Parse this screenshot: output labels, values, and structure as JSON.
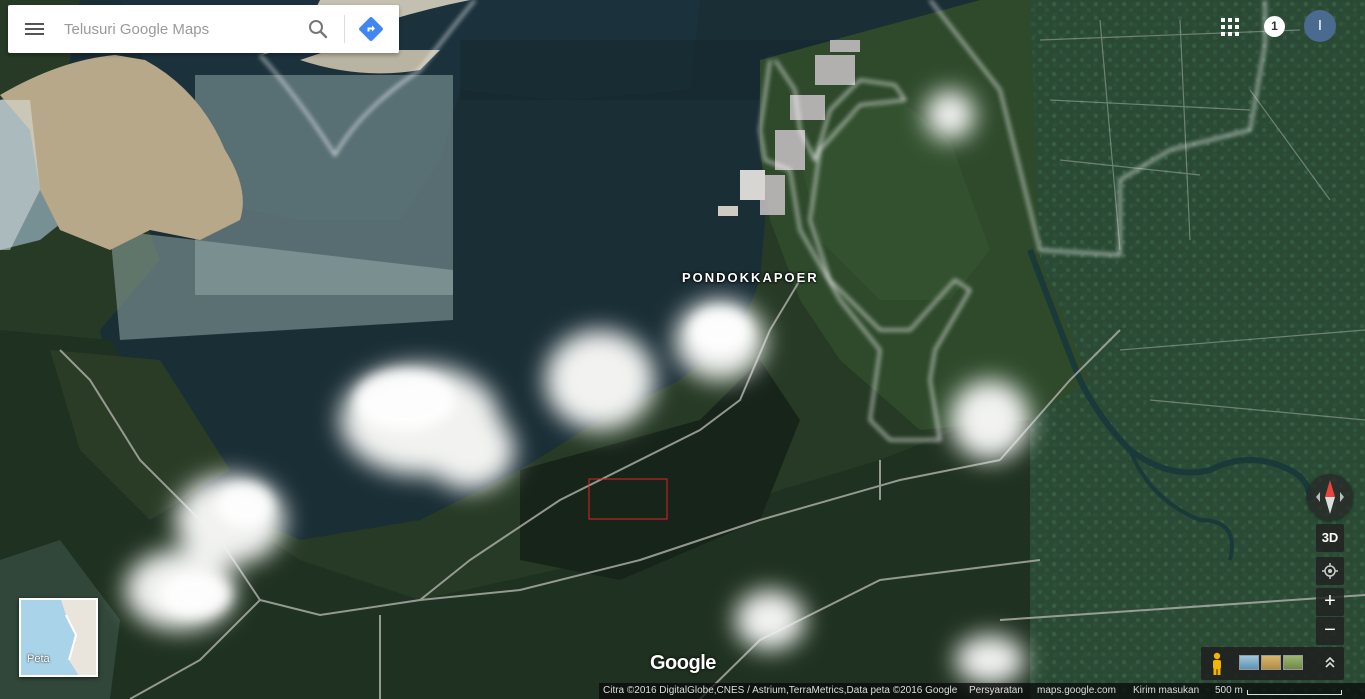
{
  "search": {
    "placeholder": "Telusuri Google Maps"
  },
  "map": {
    "place_label": "PONDOKKAPOER",
    "google_logo": "Google"
  },
  "top_right": {
    "notification_count": "1",
    "account_initial": "I"
  },
  "controls": {
    "tilt_label": "3D",
    "zoom_in": "+",
    "zoom_out": "−"
  },
  "minimap": {
    "label": "Peta"
  },
  "footer": {
    "attribution": "Citra ©2016 DigitalGlobe,CNES / Astrium,TerraMetrics,Data peta ©2016 Google",
    "terms": "Persyaratan",
    "site": "maps.google.com",
    "feedback": "Kirim masukan",
    "scale": "500 m"
  },
  "colors": {
    "water": "#1a2e36",
    "land": "#283a26",
    "sand": "#b9a98a",
    "boundary": "#ffffff",
    "highlight_box": "#e02424",
    "direction_blue": "#4285f4",
    "compass_red": "#e8453c"
  },
  "icons": [
    "menu-icon",
    "search-icon",
    "directions-icon",
    "apps-grid-icon",
    "compass-icon",
    "my-location-icon",
    "pegman-icon",
    "chevron-up-icon"
  ]
}
